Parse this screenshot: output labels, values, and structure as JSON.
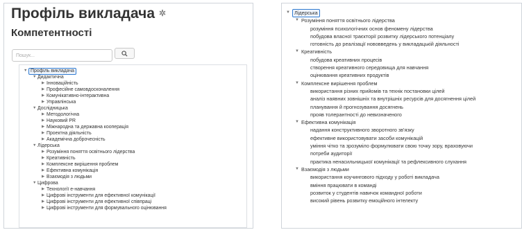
{
  "left_panel": {
    "page_title": "Профіль викладача",
    "section_title": "Компетентності",
    "search": {
      "placeholder": "Пошук..."
    },
    "tree": [
      {
        "level": 0,
        "toggle": "expanded",
        "label": "Профіль викладача",
        "selected": true
      },
      {
        "level": 1,
        "toggle": "expanded",
        "label": "Дидактична"
      },
      {
        "level": 2,
        "toggle": "collapsed",
        "label": "Інноваційність"
      },
      {
        "level": 2,
        "toggle": "collapsed",
        "label": "Професійне самовдосконалення"
      },
      {
        "level": 2,
        "toggle": "collapsed",
        "label": "Комунікативно-інтерактивна"
      },
      {
        "level": 2,
        "toggle": "collapsed",
        "label": "Управлінська"
      },
      {
        "level": 1,
        "toggle": "expanded",
        "label": "Дослідницька"
      },
      {
        "level": 2,
        "toggle": "collapsed",
        "label": "Методологічна"
      },
      {
        "level": 2,
        "toggle": "collapsed",
        "label": "Науковий PR"
      },
      {
        "level": 2,
        "toggle": "collapsed",
        "label": "Міжнародна та державна кооперація"
      },
      {
        "level": 2,
        "toggle": "collapsed",
        "label": "Проектна діяльність"
      },
      {
        "level": 2,
        "toggle": "collapsed",
        "label": "Академічна доброчесність"
      },
      {
        "level": 1,
        "toggle": "expanded",
        "label": "Лідерська"
      },
      {
        "level": 2,
        "toggle": "collapsed",
        "label": "Розуміння поняття освітнього лідерства"
      },
      {
        "level": 2,
        "toggle": "collapsed",
        "label": "Креативність"
      },
      {
        "level": 2,
        "toggle": "collapsed",
        "label": "Комплексне вирішення проблем"
      },
      {
        "level": 2,
        "toggle": "collapsed",
        "label": "Ефективна комунікація"
      },
      {
        "level": 2,
        "toggle": "collapsed",
        "label": "Взаємодія з людьми"
      },
      {
        "level": 1,
        "toggle": "expanded",
        "label": "Цифрова"
      },
      {
        "level": 2,
        "toggle": "collapsed",
        "label": "Технології е-навчання"
      },
      {
        "level": 2,
        "toggle": "collapsed",
        "label": "Цифрові інструменти для ефективної комунікації"
      },
      {
        "level": 2,
        "toggle": "collapsed",
        "label": "Цифрові інструменти для ефективної співпраці"
      },
      {
        "level": 2,
        "toggle": "collapsed",
        "label": "Цифрові інструменти для формувального оцінювання"
      }
    ]
  },
  "right_panel": {
    "tree": [
      {
        "level": 0,
        "toggle": "expanded",
        "label": "Лідерська",
        "selected": true
      },
      {
        "level": 1,
        "toggle": "expanded",
        "label": "Розуміння поняття освітнього лідерства"
      },
      {
        "level": 2,
        "toggle": "none",
        "label": "розуміння психологічних основ феномену лідерства"
      },
      {
        "level": 2,
        "toggle": "none",
        "label": "побудова власної траєкторії розвитку лідерського потенціалу"
      },
      {
        "level": 2,
        "toggle": "none",
        "label": "готовність до реалізації нововведень у викладацькій діяльності"
      },
      {
        "level": 1,
        "toggle": "expanded",
        "label": "Креативність"
      },
      {
        "level": 2,
        "toggle": "none",
        "label": "побудова креативних процесів"
      },
      {
        "level": 2,
        "toggle": "none",
        "label": "створення креативного середовища для навчання"
      },
      {
        "level": 2,
        "toggle": "none",
        "label": "оцінювання креативних продуктів"
      },
      {
        "level": 1,
        "toggle": "expanded",
        "label": "Комплексне вирішення проблем"
      },
      {
        "level": 2,
        "toggle": "none",
        "label": "використання різних прийомів та технік постановки цілей"
      },
      {
        "level": 2,
        "toggle": "none",
        "label": "аналіз наявних зовнішніх та внутрішніх ресурсів для досягнення цілей"
      },
      {
        "level": 2,
        "toggle": "none",
        "label": "планування й прогнозування досягнень"
      },
      {
        "level": 2,
        "toggle": "none",
        "label": "прояв толерантності до невизначеного"
      },
      {
        "level": 1,
        "toggle": "expanded",
        "label": "Ефективна комунікація"
      },
      {
        "level": 2,
        "toggle": "none",
        "label": "надання конструктивного зворотного зв'язку"
      },
      {
        "level": 2,
        "toggle": "none",
        "label": "ефективне використовувати засоби комунікацій"
      },
      {
        "level": 2,
        "toggle": "none",
        "label": "уміння чітко та зрозуміло формулювати свою точку зору, враховуючи"
      },
      {
        "level": 2,
        "toggle": "none",
        "label": "потреби аудиторії"
      },
      {
        "level": 2,
        "toggle": "none",
        "label": "практика ненасильницької комунікації та рефлексивного слухання"
      },
      {
        "level": 1,
        "toggle": "expanded",
        "label": "Взаємодія з людьми"
      },
      {
        "level": 2,
        "toggle": "none",
        "label": "використання коучингового підходу у роботі викладача"
      },
      {
        "level": 2,
        "toggle": "none",
        "label": "вміння працювати в команді"
      },
      {
        "level": 2,
        "toggle": "none",
        "label": "розвиток у студентів навичок командної роботи"
      },
      {
        "level": 2,
        "toggle": "none",
        "label": "високий рівень розвитку емоційного інтелекту"
      }
    ]
  },
  "colors": {
    "selection_border": "#2f7ad0",
    "panel_border": "#cfd4da"
  },
  "icons": {
    "settings": "gear-icon",
    "search": "search-icon",
    "expanded": "triangle-down-icon",
    "collapsed": "triangle-right-icon"
  }
}
